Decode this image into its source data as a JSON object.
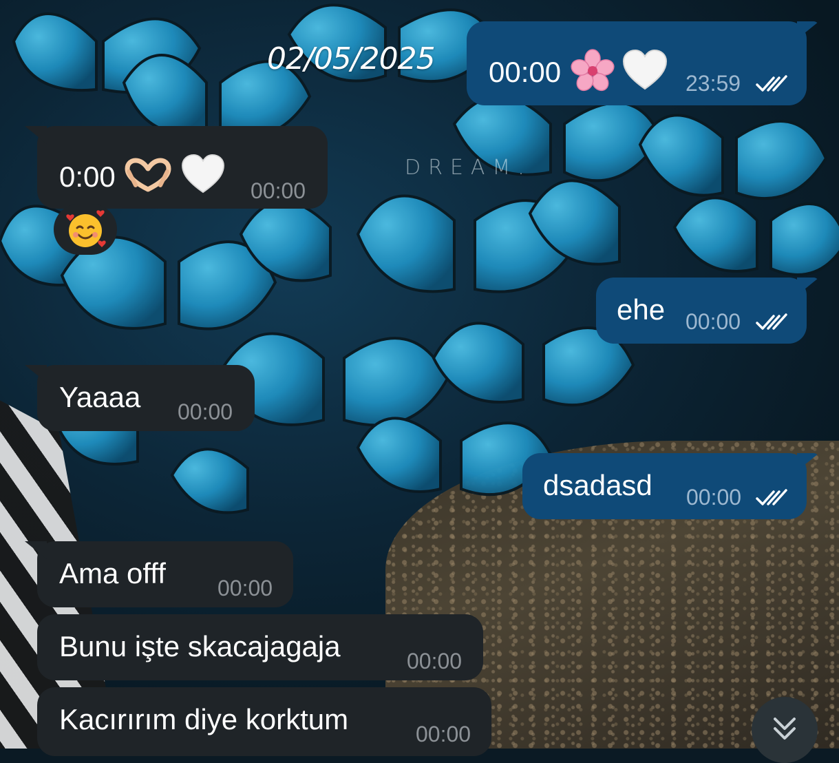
{
  "chat": {
    "date_stamp": "02/05/2025",
    "wallpaper_watermark": "DREAM.",
    "colors": {
      "outgoing_bubble": "#0f4a78",
      "incoming_bubble": "#1f2428",
      "outgoing_time": "#9db8d0",
      "incoming_time": "#8c9196"
    },
    "messages": [
      {
        "direction": "out",
        "text": "00:00",
        "emojis": [
          "cherry-blossom",
          "white-heart"
        ],
        "time": "23:59",
        "status": "read-double-check"
      },
      {
        "direction": "in",
        "text": "0:00",
        "emojis": [
          "heart-hands",
          "white-heart"
        ],
        "time": "00:00",
        "reaction": "smiling-face-with-hearts"
      },
      {
        "direction": "out",
        "text": "ehe",
        "time": "00:00",
        "status": "read-double-check"
      },
      {
        "direction": "in",
        "text": "Yaaaa",
        "time": "00:00"
      },
      {
        "direction": "out",
        "text": "dsadasd",
        "time": "00:00",
        "status": "read-double-check"
      },
      {
        "direction": "in",
        "text": "Ama offf",
        "time": "00:00"
      },
      {
        "direction": "in",
        "text": "Bunu işte skacajagaja",
        "time": "00:00"
      },
      {
        "direction": "in",
        "text": "Kacırırım diye korktum",
        "time": "00:00"
      }
    ],
    "scroll_button_icon": "double-chevron-down-icon"
  }
}
